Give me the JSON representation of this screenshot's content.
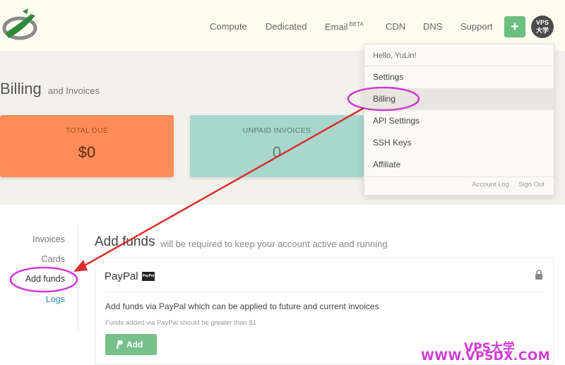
{
  "header": {
    "nav": [
      {
        "label": "Compute"
      },
      {
        "label": "Dedicated"
      },
      {
        "label": "Email",
        "badge": "BETA"
      },
      {
        "label": "CDN"
      },
      {
        "label": "DNS"
      },
      {
        "label": "Support"
      }
    ],
    "plus_label": "+",
    "avatar_text_1": "VPS",
    "avatar_text_2": "大学"
  },
  "page": {
    "title": "Billing",
    "subtitle": "and Invoices"
  },
  "cards": {
    "total_due_label": "TOTAL DUE",
    "total_due_value": "$0",
    "unpaid_label": "UNPAID INVOICES",
    "unpaid_value": "0"
  },
  "dropdown": {
    "greeting": "Hello, YuLin!",
    "items": [
      {
        "label": "Settings"
      },
      {
        "label": "Billing"
      },
      {
        "label": "API Settings"
      },
      {
        "label": "SSH Keys"
      },
      {
        "label": "Affiliate"
      }
    ],
    "account_log": "Account Log",
    "sign_out": "Sign Out"
  },
  "sidebar": {
    "items": [
      {
        "label": "Invoices"
      },
      {
        "label": "Cards"
      },
      {
        "label": "Add funds"
      },
      {
        "label": "Logs"
      }
    ]
  },
  "main": {
    "title": "Add funds",
    "subtitle": "will be required to keep your account active and running",
    "method": "PayPal",
    "badge": "PayPal",
    "description": "Add funds via PayPal which can be applied to future and current invoices",
    "note": "Funds added via PayPal should be greater than $1",
    "add_button": "Add"
  },
  "watermark": {
    "line1": "VPS大学",
    "line2": "WWW.VPSDX.COM"
  },
  "colors": {
    "accent_green": "#6bbf7f",
    "due_card": "#fd8c58",
    "unpaid_card": "#a9d6cf",
    "annotation": "#d03bd6",
    "arrow": "#d9302b"
  }
}
